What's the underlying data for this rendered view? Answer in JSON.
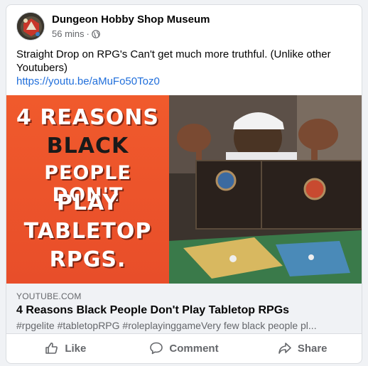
{
  "post": {
    "page_name": "Dungeon Hobby Shop Museum",
    "time": "56 mins",
    "separator": "·",
    "privacy_icon": "globe-icon",
    "text": "Straight Drop on RPG's Can't get much more truthful. (Unlike other Youtubers)",
    "link": "https://youtu.be/aMuFo50Toz0"
  },
  "link_preview": {
    "thumbnail_lines": [
      "4 REASONS",
      "BLACK",
      "PEOPLE DON'T",
      "PLAY",
      "TABLETOP",
      "RPGS."
    ],
    "domain": "YOUTUBE.COM",
    "title": "4 Reasons Black People Don't Play Tabletop RPGs",
    "description": "#rpgelite #tabletopRPG #roleplayinggameVery few black people pl..."
  },
  "actions": {
    "like": "Like",
    "comment": "Comment",
    "share": "Share"
  },
  "colors": {
    "link": "#216fdb",
    "thumbnail_bg": "#f05a2c",
    "secondary_text": "#65676b"
  }
}
